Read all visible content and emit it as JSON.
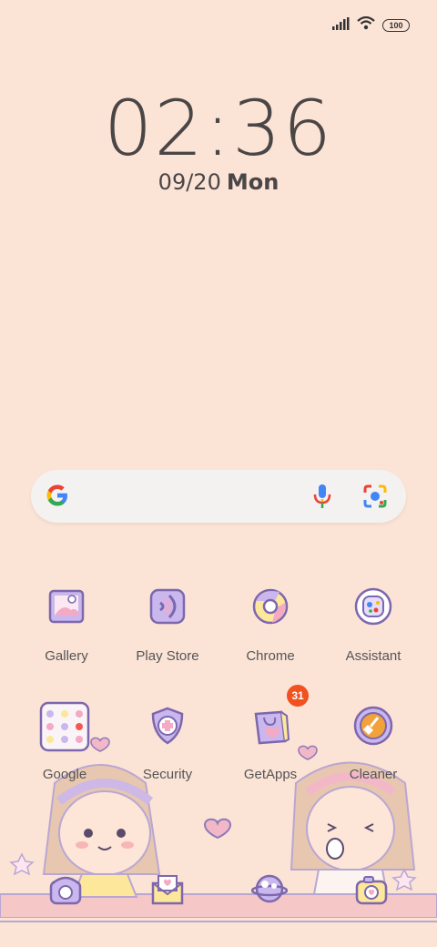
{
  "status_bar": {
    "battery": "100",
    "icons": [
      "signal-icon",
      "wifi-icon",
      "battery-icon"
    ]
  },
  "clock": {
    "time": "02:36",
    "date": "09/20",
    "weekday": "Mon"
  },
  "search_bar": {
    "logo": "google-g-icon",
    "mic": "microphone-icon",
    "lens": "google-lens-icon"
  },
  "apps": [
    {
      "label": "Gallery",
      "icon": "gallery-icon"
    },
    {
      "label": "Play Store",
      "icon": "play-store-icon"
    },
    {
      "label": "Chrome",
      "icon": "chrome-icon"
    },
    {
      "label": "Assistant",
      "icon": "assistant-icon"
    },
    {
      "label": "Google",
      "icon": "google-folder-icon"
    },
    {
      "label": "Security",
      "icon": "security-icon"
    },
    {
      "label": "GetApps",
      "icon": "getapps-icon",
      "badge": "31"
    },
    {
      "label": "Cleaner",
      "icon": "cleaner-icon"
    }
  ],
  "dock": [
    {
      "icon": "phone-icon"
    },
    {
      "icon": "messages-icon"
    },
    {
      "icon": "browser-icon"
    },
    {
      "icon": "camera-icon"
    }
  ],
  "colors": {
    "background": "#fbe3d6",
    "icon_outline": "#8d7ab8",
    "badge": "#f0511f"
  }
}
